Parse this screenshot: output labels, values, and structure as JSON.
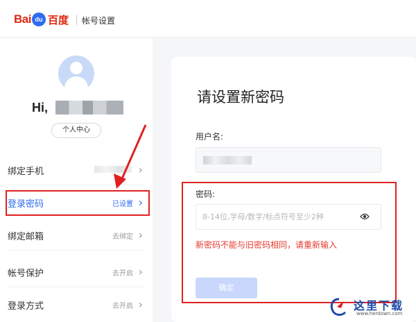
{
  "header": {
    "logo_bai": "Bai",
    "logo_paw": "du",
    "logo_du": "百度",
    "title": "帐号设置"
  },
  "profile": {
    "greeting": "Hi,",
    "center_button": "个人中心"
  },
  "sidebar": {
    "items": [
      {
        "label": "绑定手机",
        "status": "",
        "active": false
      },
      {
        "label": "登录密码",
        "status": "已设置",
        "active": true
      },
      {
        "label": "绑定邮箱",
        "status": "去绑定",
        "active": false
      },
      {
        "label": "帐号保护",
        "status": "去开启",
        "active": false
      },
      {
        "label": "登录方式",
        "status": "去开启",
        "active": false
      }
    ]
  },
  "card": {
    "title": "请设置新密码",
    "username_label": "用户名:",
    "password_label": "密码:",
    "password_placeholder": "8-14位,字母/数字/标点符号至少2种",
    "error": "新密码不能与旧密码相同，请重新输入",
    "submit_label": "确定"
  },
  "watermark": {
    "text": "这里下载",
    "url": "www.herdown.com"
  },
  "colors": {
    "accent": "#2f6df0",
    "brand_red": "#de2911",
    "annotation": "#e02020",
    "error": "#e63b2e"
  }
}
